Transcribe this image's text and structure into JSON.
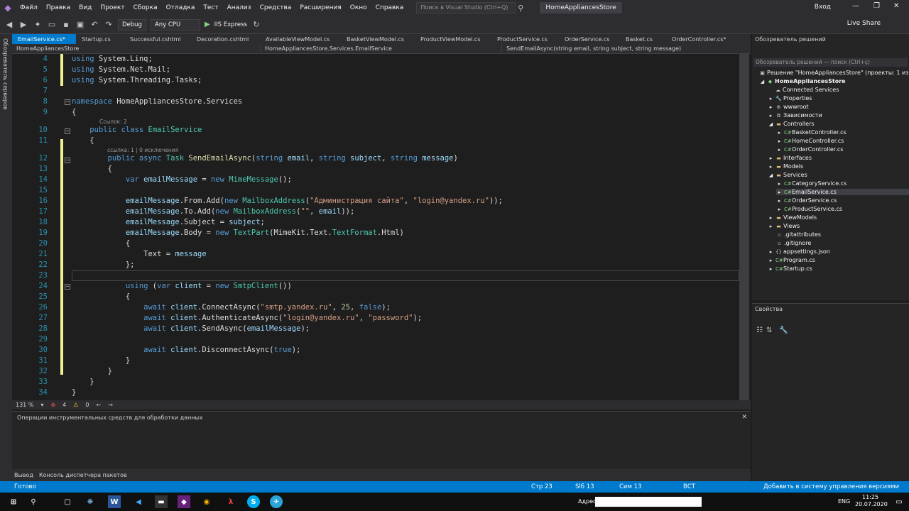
{
  "menu": [
    "Файл",
    "Правка",
    "Вид",
    "Проект",
    "Сборка",
    "Отладка",
    "Тест",
    "Анализ",
    "Средства",
    "Расширения",
    "Окно",
    "Справка"
  ],
  "search_placeholder": "Поиск в Visual Studio (Ctrl+Q)",
  "solution_name": "HomeAppliancesStore",
  "login": "Вход",
  "toolbar": {
    "config": "Debug",
    "platform": "Any CPU",
    "run": "IIS Express",
    "live_share": "Live Share"
  },
  "left_strip": "Обозреватель серверов",
  "tabs": [
    "EmailService.cs*",
    "Startup.cs",
    "Successful.cshtml",
    "Decoration.cshtml",
    "AvailableViewModel.cs",
    "BasketViewModel.cs",
    "ProductViewModel.cs",
    "ProductService.cs",
    "OrderService.cs",
    "Basket.cs",
    "OrderController.cs*"
  ],
  "navbar": {
    "project": "HomeAppliancesStore",
    "class": "HomeAppliancesStore.Services.EmailService",
    "member": "SendEmailAsync(string email, string subject, string message)"
  },
  "code_hints": {
    "refs2": "Ссылок: 2",
    "refs1": "ссылка: 1 | 0 исключения"
  },
  "editor_status": {
    "zoom": "131 %",
    "errors": "4",
    "warnings": "0"
  },
  "bottom_panel_title": "Операции инструментальных средств для обработки данных",
  "bottom_tabs": [
    "Вывод",
    "Консоль диспетчера пакетов"
  ],
  "solution_explorer": {
    "title": "Обозреватель решений",
    "search": "Обозреватель решений — поиск (Ctrl+ç)",
    "root": "Решение \"HomeAppliancesStore\" (проекты: 1 из 1)",
    "project": "HomeAppliancesStore",
    "items": [
      "Connected Services",
      "Properties",
      "wwwroot",
      "Зависимости",
      "Controllers",
      "BasketController.cs",
      "HomeController.cs",
      "OrderController.cs",
      "Interfaces",
      "Models",
      "Services",
      "CategoryService.cs",
      "EmailService.cs",
      "OrderService.cs",
      "ProductService.cs",
      "ViewModels",
      "Views",
      ".gitattributes",
      ".gitignore",
      "appsettings.json",
      "Program.cs",
      "Startup.cs"
    ]
  },
  "properties_title": "Свойства",
  "status": {
    "ready": "Готово",
    "line": "Стр 23",
    "col": "Slб 13",
    "ch": "Сим 13",
    "mode": "ВСТ",
    "vcs": "Добавить в систему управления версиями"
  },
  "taskbar": {
    "address": "Адрес",
    "lang": "ENG",
    "time": "11:25",
    "date": "20.07.2020"
  }
}
